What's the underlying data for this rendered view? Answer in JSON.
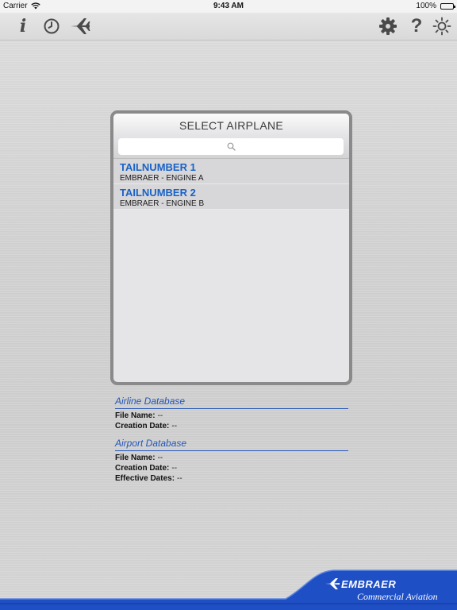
{
  "status_bar": {
    "carrier": "Carrier",
    "time": "9:43 AM",
    "battery": "100%"
  },
  "toolbar": {
    "left_icons": [
      "info-icon",
      "clock-icon",
      "airplane-icon"
    ],
    "right_icons": [
      "gear-icon",
      "help-icon",
      "brightness-icon"
    ],
    "info_glyph": "i",
    "help_glyph": "?"
  },
  "panel": {
    "title": "SELECT AIRPLANE",
    "search_placeholder": "",
    "airplanes": [
      {
        "tail": "TAILNUMBER 1",
        "model": "EMBRAER - ENGINE A"
      },
      {
        "tail": "TAILNUMBER 2",
        "model": "EMBRAER - ENGINE B"
      }
    ]
  },
  "airline_db": {
    "title": "Airline Database",
    "file_name_label": "File Name:",
    "file_name": "--",
    "creation_date_label": "Creation Date:",
    "creation_date": "--"
  },
  "airport_db": {
    "title": "Airport Database",
    "file_name_label": "File Name:",
    "file_name": "--",
    "creation_date_label": "Creation Date:",
    "creation_date": "--",
    "effective_dates_label": "Effective Dates:",
    "effective_dates": "--"
  },
  "footer": {
    "brand": "EMBRAER",
    "tagline": "Commercial Aviation"
  },
  "colors": {
    "accent_blue": "#1862c7",
    "footer_blue": "#1f4fc4",
    "icon_gray": "#4a4a4a"
  }
}
